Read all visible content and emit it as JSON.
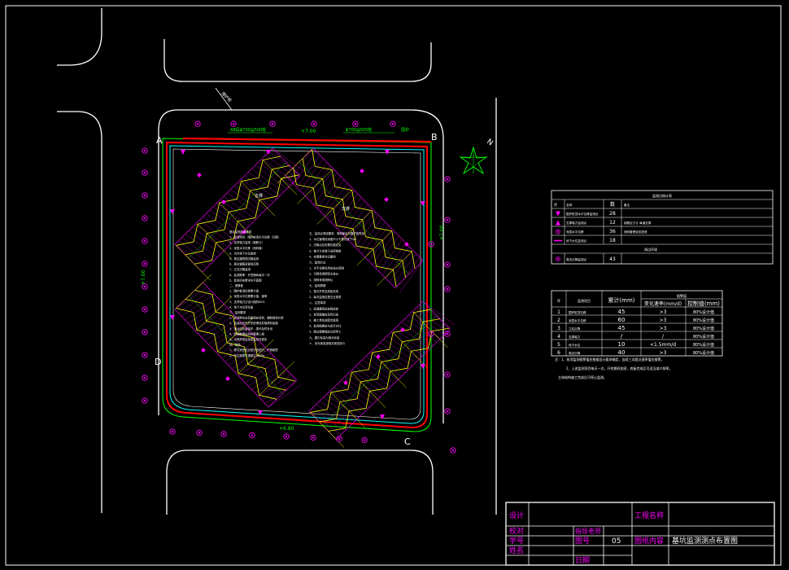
{
  "colors": {
    "background": "#000000",
    "frame": "#ffffff",
    "pit_edge": "#ff0000",
    "inner_edge": "#00ffff",
    "green": "#00ff00",
    "truss": "#ffff00",
    "marker": "#ff00ff",
    "note_text": "#ffffff"
  },
  "labels": {
    "corner_a": "A",
    "corner_b": "B",
    "corner_c": "C",
    "corner_d": "D",
    "level_top": "+7.00",
    "level_right": "+7.00",
    "level_left": "+7.00",
    "level_bottom": "+6.80",
    "top_left_callout": "AB段ϕ700@500桩",
    "top_right_callout": "ϕ700@500桩",
    "top_right_side": "围护",
    "diag_callout": "围护桩",
    "inner_left_tag": "支撑",
    "inner_right_tag": "支撑",
    "north_glyph": "N"
  },
  "notes": {
    "left_col": [
      "基坑监测技术要求",
      "1、监测项目：围护桩顶水平位移（沉降）",
      "2、支撑轴力监测（钢筋计）",
      "3、深层水平位移（测斜管）",
      "4、坑外地下水位监测",
      "5、周边建筑物沉降监测",
      "6、周边道路及管线沉降",
      "7、立柱沉降监测",
      "8、监测频率：开挖期间每天一次",
      "9、监测点布置详见平面图",
      "二、报警值",
      "1、围护桩顶位移累计值",
      "2、深层水平位移累计值、速率",
      "3、支撑轴力达设计值的80%",
      "4、地下水位变化量",
      "三、监测要求",
      "1、监测单位应具备相应资质，编制监测方案",
      "2、监测点应在开挖前埋设并取得初始值",
      "3、测点应妥善保护，损坏及时补设",
      "4、监测数据应及时整理上报",
      "5、出现异常应加密监测并报告",
      "四、其他",
      "1、基坑开挖应分层分段进行，严禁超挖",
      "2、坑边堆载不得超过20kPa"
    ],
    "right_col": [
      "五、监测点埋设要求，测斜管应与围护桩同深",
      "1、水位管埋设深度不小于基坑底下5m",
      "2、沉降点应布置在稳定处",
      "3、轴力计安装于支撑端部",
      "4、布置要求详见图例",
      "六、监测方法",
      "1、水平位移采用全站仪观测",
      "2、沉降采用精密水准仪",
      "3、测斜采用测斜仪",
      "七、监测周期",
      "1、基坑开挖至底板完成",
      "2、每次监测应提交日报表",
      "八、注意事项",
      "1、如遇暴雨应加强巡查",
      "2、发现裂缝应及时记录",
      "3、施工单位应配合监测",
      "4、监测结果应与设计对比",
      "5、超过报警值应立即停工",
      "九、图中标高为相对标高",
      "十、未尽事宜按相关规范执行"
    ]
  },
  "legend": {
    "title": "监测点统计表",
    "rows": [
      {
        "code": "",
        "name": "名称",
        "count": "数",
        "note": "备注"
      },
      {
        "code": "1",
        "name": "围护桩顶水平位移监测点",
        "count": "28",
        "note": ""
      },
      {
        "code": "2",
        "name": "支撑轴力监测点",
        "count": "12",
        "note": "钢筋应力计 每道支撑"
      },
      {
        "code": "3",
        "name": "深层水平位移",
        "count": "36",
        "note": "测斜管埋设至桩底"
      },
      {
        "code": "4",
        "name": "地下水位监测点",
        "count": "18",
        "note": ""
      }
    ],
    "sub_title": "周边环境",
    "extra_row": {
      "code": "5",
      "name": "周边沉降监测点",
      "count": "43",
      "note": ""
    }
  },
  "alarm_table": {
    "header_group": "报警值",
    "col_no": "序",
    "col_item": "监测项目",
    "col_cum": "累计(mm)",
    "col_rate": "变化速率(mm/d)",
    "col_design": "控制值(mm)",
    "rows": [
      {
        "no": "1",
        "item": "围护桩顶位移",
        "cum": "45",
        "rate": ">3",
        "design": "80%设计值"
      },
      {
        "no": "2",
        "item": "深层水平位移",
        "cum": "60",
        "rate": ">3",
        "design": "80%设计值"
      },
      {
        "no": "3",
        "item": "立柱沉降",
        "cum": "45",
        "rate": ">3",
        "design": "80%设计值"
      },
      {
        "no": "4",
        "item": "支撑轴力",
        "cum": "/",
        "rate": "/",
        "design": "80%设计值"
      },
      {
        "no": "5",
        "item": "地下水位",
        "cum": "10",
        "rate": "<1.5mm/d",
        "design": "80%设计值"
      },
      {
        "no": "6",
        "item": "周边沉降",
        "cum": "40",
        "rate": ">3",
        "design": "80%设计值"
      }
    ],
    "note1": "注：1、各项监测报警值应根据设计要求确定，连续三次超过速率值应报警。",
    "note2": "2、上述监测项目每天一次，开挖期间加密，底板完成后可适当减少频率。",
    "note3": "主体结构施工完成后可停止监测。"
  },
  "title_block": {
    "r1_label": "设计",
    "r2_label": "校对",
    "r3_label": "学号",
    "r4_label": "姓名",
    "advisor_label": "指导老师",
    "figno_label": "图号",
    "figno_value": "05",
    "date_label": "日期",
    "project_label": "工程名称",
    "drawing_label": "图纸内容",
    "drawing_value": "基坑监测测点布置图"
  }
}
